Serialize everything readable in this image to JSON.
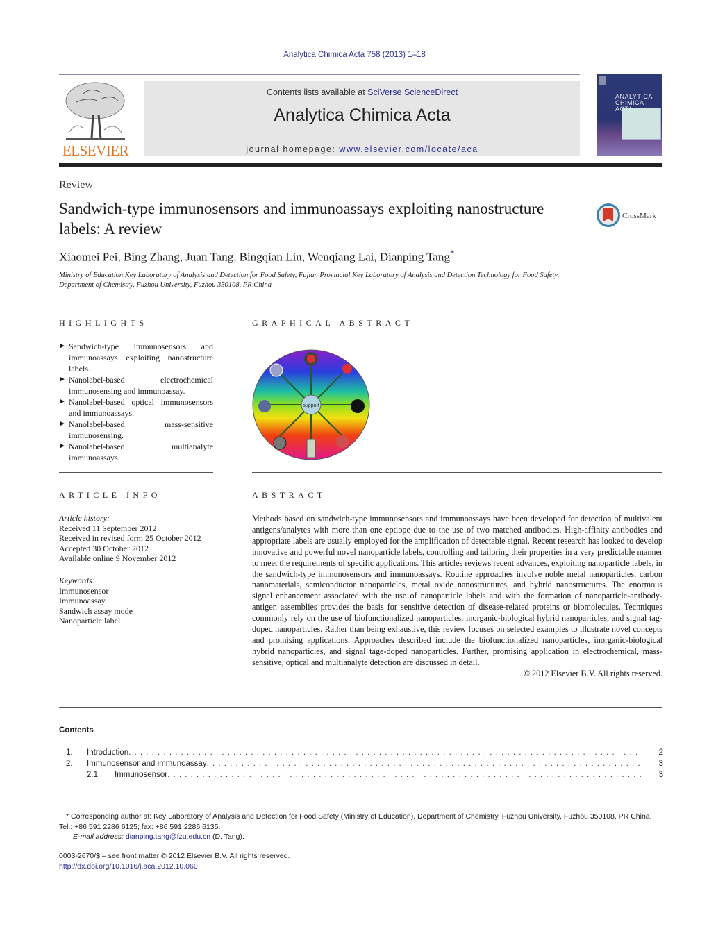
{
  "header": {
    "journal_ref": "Analytica Chimica Acta 758 (2013) 1–18",
    "contents_prefix": "Contents lists available at ",
    "contents_link": "SciVerse ScienceDirect",
    "journal_name": "Analytica Chimica Acta",
    "homepage_prefix": "journal homepage: ",
    "homepage_link": "www.elsevier.com/locate/aca",
    "publisher_logo": "ELSEVIER",
    "cover_title_line1": "ANALYTICA",
    "cover_title_line2": "CHIMICA ACTA"
  },
  "article": {
    "type": "Review",
    "title": "Sandwich-type immunosensors and immunoassays exploiting nanostructure labels: A review",
    "crossmark": "CrossMark",
    "authors": "Xiaomei Pei, Bing Zhang, Juan Tang, Bingqian Liu, Wenqiang Lai, Dianping Tang",
    "author_mark": "*",
    "affiliation": "Ministry of Education Key Laboratory of Analysis and Detection for Food Safety, Fujian Provincial Key Laboratory of Analysis and Detection Technology for Food Safety, Department of Chemistry, Fuzhou University, Fuzhou 350108, PR China"
  },
  "highlights": {
    "heading": "HIGHLIGHTS",
    "items": [
      "Sandwich-type immunosensors and immunoassays exploiting nanostructure labels.",
      "Nanolabel-based electrochemical immunosensing and immunoassay.",
      "Nanolabel-based optical immunosensors and immunoassays.",
      "Nanolabel-based mass-sensitive immunosensing.",
      "Nanolabel-based multianalyte immunoassays."
    ]
  },
  "graphical_abstract": {
    "heading": "GRAPHICAL ABSTRACT",
    "center_label": "support"
  },
  "article_info": {
    "heading": "ARTICLE INFO",
    "history_label": "Article history:",
    "history": [
      "Received 11 September 2012",
      "Received in revised form 25 October 2012",
      "Accepted 30 October 2012",
      "Available online 9 November 2012"
    ],
    "keywords_label": "Keywords:",
    "keywords": [
      "Immunosensor",
      "Immunoassay",
      "Sandwich assay mode",
      "Nanoparticle label"
    ]
  },
  "abstract": {
    "heading": "ABSTRACT",
    "text": "Methods based on sandwich-type immunosensors and immunoassays have been developed for detection of multivalent antigens/analytes with more than one eptiope due to the use of two matched antibodies. High-affinity antibodies and appropriate labels are usually employed for the amplification of detectable signal. Recent research has looked to develop innovative and powerful novel nanoparticle labels, controlling and tailoring their properties in a very predictable manner to meet the requirements of specific applications. This articles reviews recent advances, exploiting nanoparticle labels, in the sandwich-type immunosensors and immunoassays. Routine approaches involve noble metal nanoparticles, carbon nanomaterials, semiconductor nanoparticles, metal oxide nanostructures, and hybrid nanostructures. The enormous signal enhancement associated with the use of nanoparticle labels and with the formation of nanoparticle-antibody-antigen assemblies provides the basis for sensitive detection of disease-related proteins or biomolecules. Techniques commonly rely on the use of biofunctionalized nanoparticles, inorganic-biological hybrid nanoparticles, and signal tag-doped nanoparticles. Rather than being exhaustive, this review focuses on selected examples to illustrate novel concepts and promising applications. Approaches described include the biofunctionalized nanoparticles, inorganic-biological hybrid nanoparticles, and signal tage-doped nanoparticles. Further, promising application in electrochemical, mass-sensitive, optical and multianalyte detection are discussed in detail.",
    "copyright": "© 2012 Elsevier B.V. All rights reserved."
  },
  "contents": {
    "heading": "Contents",
    "entries": [
      {
        "num": "1.",
        "title": "Introduction",
        "page": "2"
      },
      {
        "num": "2.",
        "title": "Immunosensor and immunoassay",
        "page": "3"
      },
      {
        "num": "2.1.",
        "title": "Immunosensor",
        "page": "3"
      }
    ]
  },
  "footnote": {
    "mark": "*",
    "text": "Corresponding author at: Key Laboratory of Analysis and Detection for Food Safety (Ministry of Education), Department of Chemistry, Fuzhou University, Fuzhou 350108, PR China. Tel.: +86 591 2286 6125; fax: +86 591 2286 6135.",
    "email_label": "E-mail address:",
    "email": "dianping.tang@fzu.edu.cn",
    "email_suffix": " (D. Tang)."
  },
  "front_matter": {
    "issn_line": "0003-2670/$ – see front matter © 2012 Elsevier B.V. All rights reserved.",
    "doi": "http://dx.doi.org/10.1016/j.aca.2012.10.060"
  }
}
